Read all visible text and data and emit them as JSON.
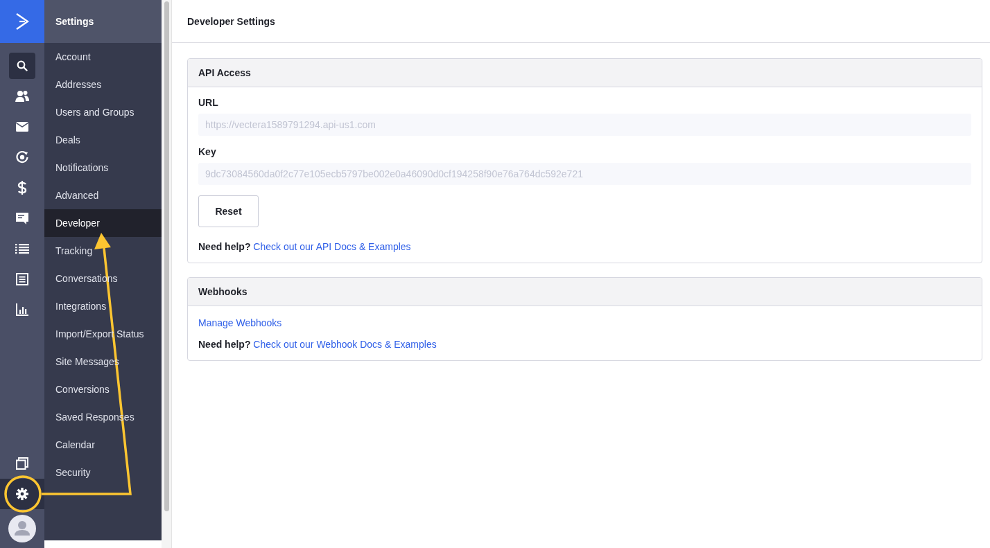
{
  "rail": {
    "items": [
      {
        "kind": "search",
        "selected": true
      },
      {
        "kind": "contacts",
        "selected": false
      },
      {
        "kind": "mail",
        "selected": false
      },
      {
        "kind": "automation",
        "selected": false
      },
      {
        "kind": "dollar",
        "selected": false
      },
      {
        "kind": "chat",
        "selected": false
      },
      {
        "kind": "list",
        "selected": false
      },
      {
        "kind": "document",
        "selected": false
      },
      {
        "kind": "chart",
        "selected": false
      }
    ],
    "bottom": [
      {
        "kind": "pages",
        "selected": false
      },
      {
        "kind": "gear",
        "selected": true
      },
      {
        "kind": "avatar",
        "selected": false
      }
    ]
  },
  "settings_menu": {
    "title": "Settings",
    "items": [
      {
        "label": "Account",
        "selected": false
      },
      {
        "label": "Addresses",
        "selected": false
      },
      {
        "label": "Users and Groups",
        "selected": false
      },
      {
        "label": "Deals",
        "selected": false
      },
      {
        "label": "Notifications",
        "selected": false
      },
      {
        "label": "Advanced",
        "selected": false
      },
      {
        "label": "Developer",
        "selected": true
      },
      {
        "label": "Tracking",
        "selected": false
      },
      {
        "label": "Conversations",
        "selected": false
      },
      {
        "label": "Integrations",
        "selected": false
      },
      {
        "label": "Import/Export Status",
        "selected": false
      },
      {
        "label": "Site Messages",
        "selected": false
      },
      {
        "label": "Conversions",
        "selected": false
      },
      {
        "label": "Saved Responses",
        "selected": false
      },
      {
        "label": "Calendar",
        "selected": false
      },
      {
        "label": "Security",
        "selected": false
      }
    ]
  },
  "page": {
    "title": "Developer Settings"
  },
  "api_access": {
    "title": "API Access",
    "fields": [
      {
        "label": "URL",
        "value": "https://vectera1589791294.api-us1.com"
      },
      {
        "label": "Key",
        "value": "9dc73084560da0f2c77e105ecb5797be002e0a46090d0cf194258f90e76a764dc592e721"
      }
    ],
    "button": "Reset",
    "help": {
      "prefix": "Need help?",
      "link": "Check out our API Docs & Examples"
    }
  },
  "webhooks": {
    "title": "Webhooks",
    "link": "Manage Webhooks",
    "help": {
      "prefix": "Need help?",
      "link": "Check out our Webhook Docs & Examples"
    }
  }
}
